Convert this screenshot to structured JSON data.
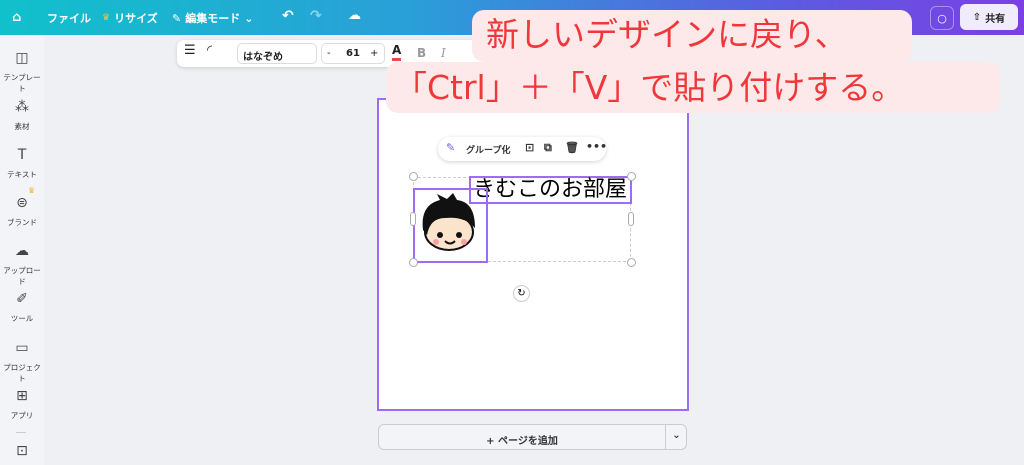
{
  "header": {
    "file": "ファイル",
    "resize": "リサイズ",
    "edit_mode": "編集モード",
    "share": "共有"
  },
  "sidebar": {
    "items": [
      {
        "label": "テンプレート",
        "icon": "template-icon"
      },
      {
        "label": "素材",
        "icon": "elements-icon"
      },
      {
        "label": "テキスト",
        "icon": "text-icon"
      },
      {
        "label": "ブランド",
        "icon": "brand-icon"
      },
      {
        "label": "アップロード",
        "icon": "upload-icon"
      },
      {
        "label": "ツール",
        "icon": "tools-icon"
      },
      {
        "label": "プロジェクト",
        "icon": "folder-icon"
      },
      {
        "label": "アプリ",
        "icon": "apps-icon"
      }
    ]
  },
  "toolbar": {
    "font": "はなぞめ",
    "font_size": "61",
    "minus": "-",
    "plus": "+",
    "bold": "B",
    "italic": "I"
  },
  "context_menu": {
    "group": "グループ化"
  },
  "canvas": {
    "text": "きむこのお部屋"
  },
  "add_page": "+ ページを追加",
  "callout": {
    "line1": "新しいデザインに戻り、",
    "line2": "「Ctrl」＋「V」で貼り付けする。"
  },
  "colors": {
    "accent": "#9d6cf0",
    "callout_text": "#f0383a",
    "callout_bg": "#fde9e9"
  }
}
